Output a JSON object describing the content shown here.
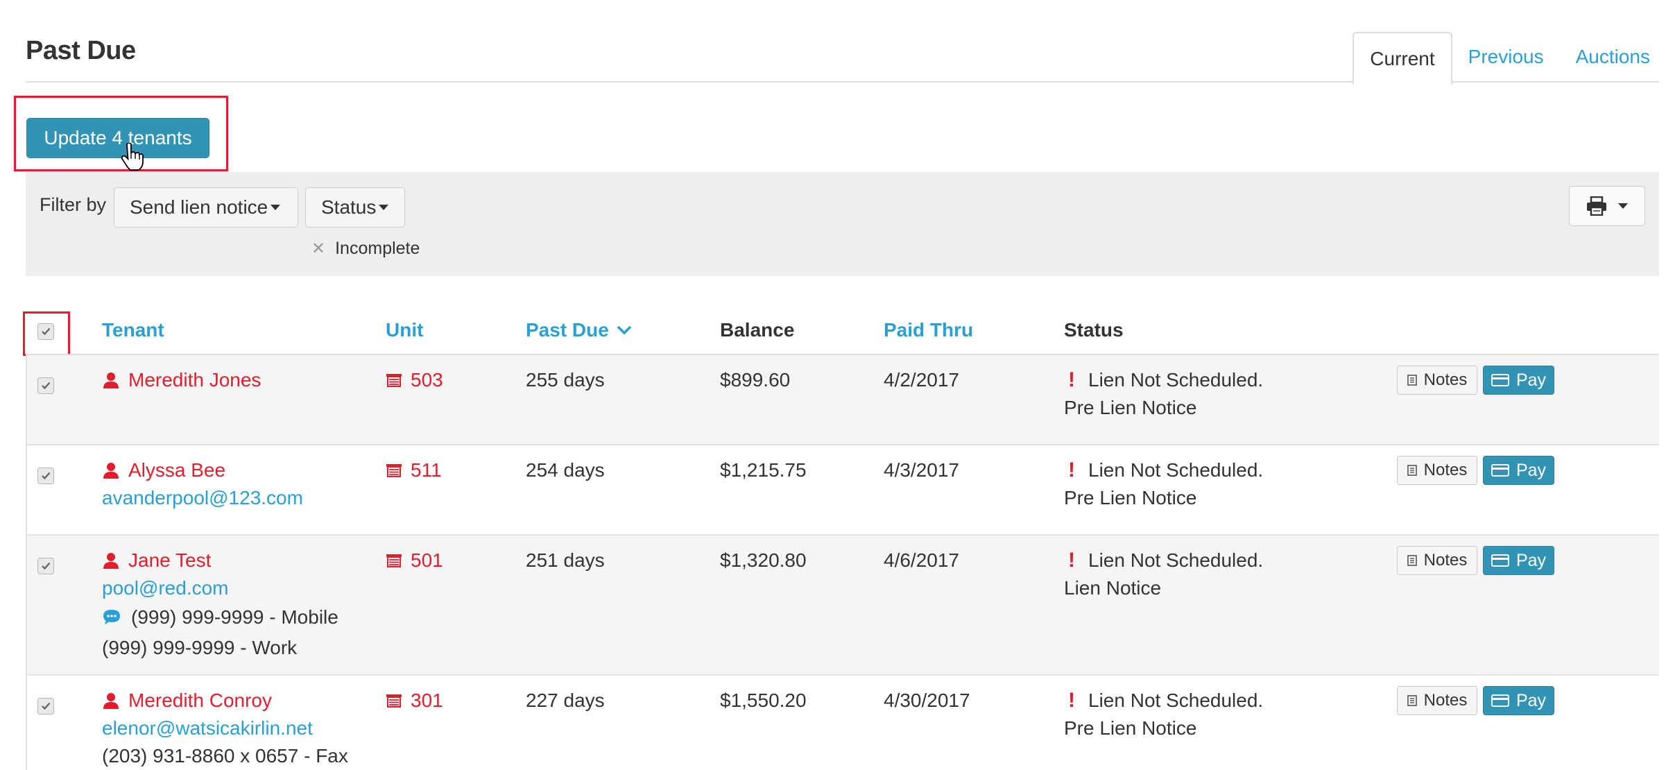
{
  "page": {
    "title": "Past Due"
  },
  "tabs": [
    {
      "label": "Current",
      "active": true
    },
    {
      "label": "Previous",
      "active": false
    },
    {
      "label": "Auctions",
      "active": false
    }
  ],
  "actions": {
    "update_label": "Update 4 tenants"
  },
  "filter": {
    "label": "Filter by",
    "send_lien_notice": "Send lien notice",
    "status": "Status",
    "active_chip": "Incomplete"
  },
  "table": {
    "columns": {
      "tenant": "Tenant",
      "unit": "Unit",
      "past_due": "Past Due",
      "balance": "Balance",
      "paid_thru": "Paid Thru",
      "status": "Status"
    },
    "notes_label": "Notes",
    "pay_label": "Pay",
    "rows": [
      {
        "checked": true,
        "name": "Meredith Jones",
        "email": "",
        "phone_mobile": "",
        "phone_other": "",
        "unit": "503",
        "past_due": "255 days",
        "balance": "$899.60",
        "paid_thru": "4/2/2017",
        "status_main": "Lien Not Scheduled.",
        "status_sub": "Pre Lien Notice"
      },
      {
        "checked": true,
        "name": "Alyssa Bee",
        "email": "avanderpool@123.com",
        "phone_mobile": "",
        "phone_other": "",
        "unit": "511",
        "past_due": "254 days",
        "balance": "$1,215.75",
        "paid_thru": "4/3/2017",
        "status_main": "Lien Not Scheduled.",
        "status_sub": "Pre Lien Notice"
      },
      {
        "checked": true,
        "name": "Jane Test",
        "email": "pool@red.com",
        "phone_mobile": "(999) 999-9999 - Mobile",
        "phone_other": "(999) 999-9999 - Work",
        "unit": "501",
        "past_due": "251 days",
        "balance": "$1,320.80",
        "paid_thru": "4/6/2017",
        "status_main": "Lien Not Scheduled.",
        "status_sub": "Lien Notice"
      },
      {
        "checked": true,
        "name": "Meredith Conroy",
        "email": "elenor@watsicakirlin.net",
        "phone_mobile": "",
        "phone_other": "(203) 931-8860 x 0657 - Fax",
        "unit": "301",
        "past_due": "227 days",
        "balance": "$1,550.20",
        "paid_thru": "4/30/2017",
        "status_main": "Lien Not Scheduled.",
        "status_sub": "Pre Lien Notice"
      }
    ]
  },
  "colors": {
    "link_blue": "#2a9fd6",
    "button_blue": "#3393b5",
    "alert_red": "#e31d2c",
    "highlight_red": "#e31d2c"
  }
}
